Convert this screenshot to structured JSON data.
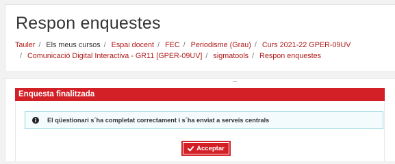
{
  "header": {
    "title": "Respon enquestes",
    "breadcrumb_row1": [
      "Tauler",
      "Els meus cursos",
      "Espai docent",
      "FEC",
      "Periodisme (Grau)",
      "Curs 2021-22 GPER-09UV"
    ],
    "breadcrumb_row2": [
      "Comunicació Digital Interactiva - GR11 [GPER-09UV]",
      "sigmatools",
      "Respon enquestes"
    ]
  },
  "panel": {
    "heading": "Enquesta finalitzada",
    "alert_text": "El qüestionari s´ha completat correctament i s´ha enviat a serveis centrals",
    "alert_icon": "info-circle-icon",
    "button_label": "Acceptar",
    "button_icon": "check-icon"
  },
  "colors": {
    "accent": "#d31f26",
    "link": "#b01a1a",
    "alert_border": "#8fd4de",
    "alert_bg": "#f4fbfc"
  }
}
